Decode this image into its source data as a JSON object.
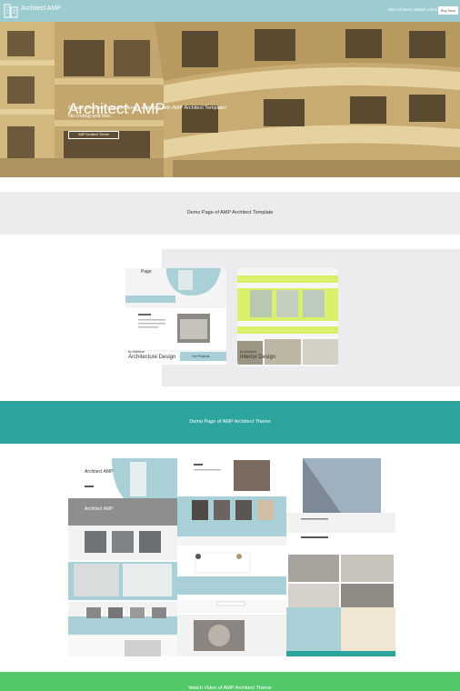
{
  "header": {
    "brand": "Architect AMP",
    "nav": [
      "View All Demo",
      "Watch Video"
    ],
    "buy_label": "Buy Now"
  },
  "hero": {
    "title": "Architect AMP",
    "line1": "Create awesome mobile-friendly websites with AMP Architect Template!",
    "line2": "No coding and free.",
    "button_label": "AMP Architect Theme"
  },
  "demo_template": {
    "heading": "Demo Page of AMP Architect Template",
    "cards": [
      {
        "byline": "by Mobirise",
        "title": "Architecture Design",
        "inner_title": "Page",
        "inner_button": "Our Projects"
      },
      {
        "byline": "by Mobirise",
        "title": "Interior Design"
      }
    ]
  },
  "demo_theme": {
    "heading": "Demo Page of AMP Architect Theme",
    "preview_title": "Architect AMP",
    "preview_overlay": "Architect AMP"
  },
  "video": {
    "heading": "Watch Video of AMP Architect Theme"
  },
  "colors": {
    "topbar": "#9ccbd0",
    "teal": "#2ea49e",
    "green": "#53c86b",
    "lime": "#d8f06a",
    "light_blue": "#a9d0d6"
  }
}
